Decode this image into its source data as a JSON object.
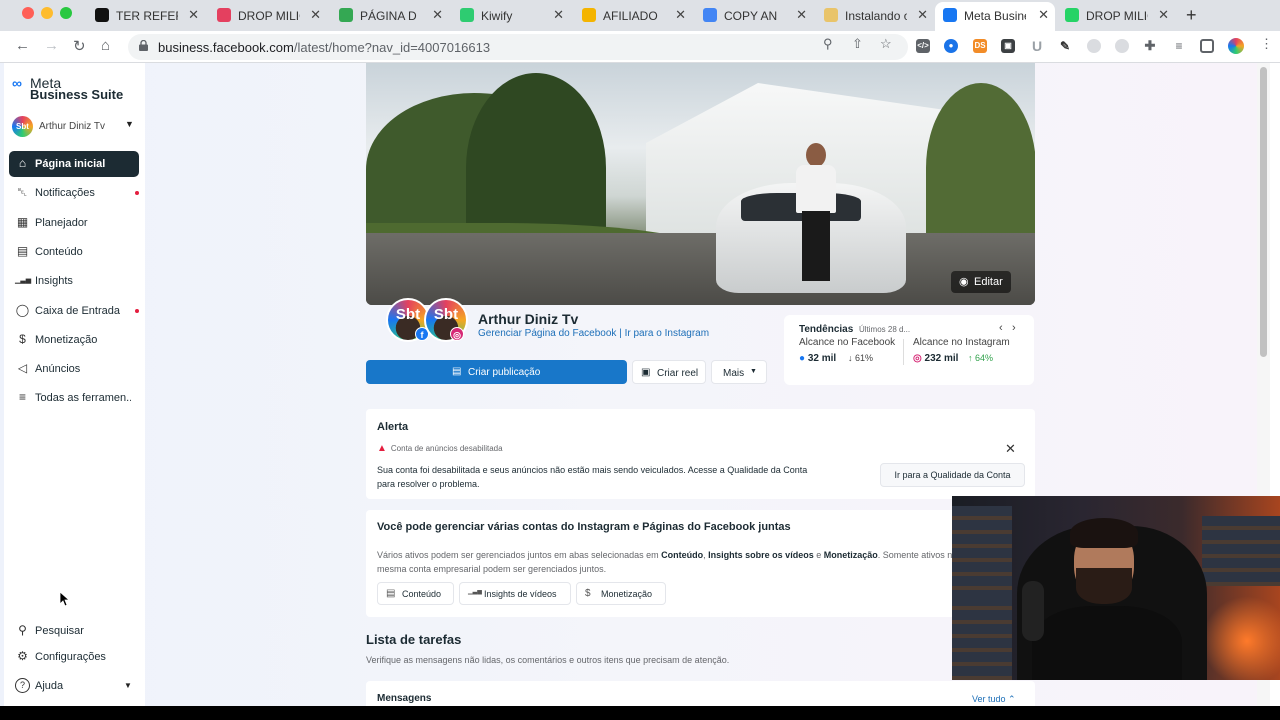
{
  "browser": {
    "tabs": [
      {
        "title": "TER REFERÊ",
        "icon": "notion-icon",
        "color": "#111111"
      },
      {
        "title": "DROP MILIO",
        "icon": "instagram-icon",
        "color": "#e4405f"
      },
      {
        "title": "PÁGINA D",
        "icon": "globe-icon",
        "color": "#34a853"
      },
      {
        "title": "Kiwify",
        "icon": "kiwify-icon",
        "color": "#2ecc71"
      },
      {
        "title": "AFILIADO",
        "icon": "drive-icon",
        "color": "#f4b400"
      },
      {
        "title": "COPY AN",
        "icon": "docs-icon",
        "color": "#4285f4"
      },
      {
        "title": "Instalando o",
        "icon": "wordpress-icon",
        "color": "#e9c46a"
      },
      {
        "title": "Meta Busine",
        "icon": "meta-icon",
        "color": "#1877f2"
      },
      {
        "title": "DROP MILIO",
        "icon": "whatsapp-icon",
        "color": "#25d366"
      }
    ],
    "active_tab": 7,
    "url_host": "business.facebook.com",
    "url_path": "/latest/home?nav_id=4007016613"
  },
  "sidebar": {
    "logo_line1": "Meta",
    "logo_line2": "Business Suite",
    "account_name": "Arthur Diniz Tv",
    "account_initials": "Sbt",
    "items": [
      {
        "label": "Página inicial",
        "icon": "home-icon",
        "active": true,
        "dot": false
      },
      {
        "label": "Notificações",
        "icon": "bell-icon",
        "active": false,
        "dot": true
      },
      {
        "label": "Planejador",
        "icon": "calendar-grid-icon",
        "active": false,
        "dot": false
      },
      {
        "label": "Conteúdo",
        "icon": "content-icon",
        "active": false,
        "dot": false
      },
      {
        "label": "Insights",
        "icon": "bar-chart-icon",
        "active": false,
        "dot": false
      },
      {
        "label": "Caixa de Entrada",
        "icon": "chat-bubble-icon",
        "active": false,
        "dot": true
      },
      {
        "label": "Monetização",
        "icon": "dollar-circle-icon",
        "active": false,
        "dot": false
      },
      {
        "label": "Anúncios",
        "icon": "megaphone-icon",
        "active": false,
        "dot": false
      },
      {
        "label": "Todas as ferramen...",
        "icon": "menu-lines-icon",
        "active": false,
        "dot": false
      }
    ],
    "bottom": [
      {
        "label": "Pesquisar",
        "icon": "search-icon"
      },
      {
        "label": "Configurações",
        "icon": "gear-icon"
      },
      {
        "label": "Ajuda",
        "icon": "help-icon"
      }
    ]
  },
  "profile": {
    "edit_label": "Editar",
    "name": "Arthur Diniz Tv",
    "avatar_text": "Sbt",
    "link_page": "Gerenciar Página do Facebook",
    "link_separator": " | ",
    "link_ig": "Ir para o Instagram"
  },
  "actions": {
    "create_post": "Criar publicação",
    "create_reel": "Criar reel",
    "more": "Mais"
  },
  "trends": {
    "title": "Tendências",
    "subtitle": "Últimos 28 d...",
    "fb_label": "Alcance no Facebook",
    "fb_value": "32 mil",
    "fb_change": "61%",
    "ig_label": "Alcance no Instagram",
    "ig_value": "232 mil",
    "ig_change": "64%",
    "down_color": "#444444",
    "up_color": "#31a24c"
  },
  "alert": {
    "title": "Alerta",
    "subtitle": "Conta de anúncios desabilitada",
    "body": "Sua conta foi desabilitada e seus anúncios não estão mais sendo veiculados. Acesse a Qualidade da Conta para resolver o problema.",
    "button": "Ir para a Qualidade da Conta"
  },
  "manage": {
    "title": "Você pode gerenciar várias contas do Instagram e Páginas do Facebook juntas",
    "body_1": "Vários ativos podem ser gerenciados juntos em abas selecionadas em ",
    "body_b1": "Conteúdo",
    "body_2": ", ",
    "body_b2": "Insights sobre os vídeos",
    "body_3": " e ",
    "body_b3": "Monetização",
    "body_4": ". Somente ativos na mesma conta empresarial podem ser gerenciados juntos.",
    "chips": [
      {
        "label": "Conteúdo",
        "icon": "content-icon"
      },
      {
        "label": "Insights de vídeos",
        "icon": "bar-chart-icon"
      },
      {
        "label": "Monetização",
        "icon": "dollar-circle-icon"
      }
    ]
  },
  "tasks": {
    "title": "Lista de tarefas",
    "subtitle": "Verifique as mensagens não lidas, os comentários e outros itens que precisam de atenção.",
    "messages_title": "Mensagens",
    "see_all": "Ver tudo"
  }
}
